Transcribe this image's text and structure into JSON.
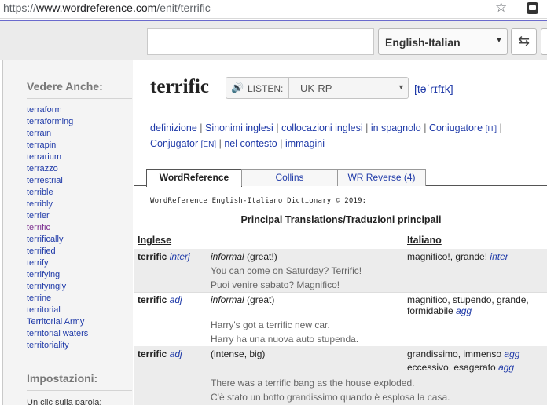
{
  "browser": {
    "url_prefix": "https://",
    "url_host": "www.wordreference.com",
    "url_path": "/enit/terrific",
    "star_glyph": "☆"
  },
  "topbar": {
    "search_value": "",
    "dictionary": "English-Italian",
    "dropdown_caret": "▼",
    "swap_glyph": "⇆"
  },
  "sidebar": {
    "see_also_title": "Vedere Anche:",
    "items": [
      {
        "label": "terraform",
        "visited": false
      },
      {
        "label": "terraforming",
        "visited": false
      },
      {
        "label": "terrain",
        "visited": false
      },
      {
        "label": "terrapin",
        "visited": false
      },
      {
        "label": "terrarium",
        "visited": false
      },
      {
        "label": "terrazzo",
        "visited": false
      },
      {
        "label": "terrestrial",
        "visited": false
      },
      {
        "label": "terrible",
        "visited": false
      },
      {
        "label": "terribly",
        "visited": false
      },
      {
        "label": "terrier",
        "visited": false
      },
      {
        "label": "terrific",
        "visited": true
      },
      {
        "label": "terrifically",
        "visited": false
      },
      {
        "label": "terrified",
        "visited": false
      },
      {
        "label": "terrify",
        "visited": false
      },
      {
        "label": "terrifying",
        "visited": false
      },
      {
        "label": "terrifyingly",
        "visited": false
      },
      {
        "label": "terrine",
        "visited": false
      },
      {
        "label": "territorial",
        "visited": false
      },
      {
        "label": "Territorial Army",
        "visited": false
      },
      {
        "label": "territorial waters",
        "visited": false
      },
      {
        "label": "territoriality",
        "visited": false
      }
    ],
    "settings_title": "Impostazioni:",
    "settings_first": "Un clic sulla parola:"
  },
  "entry": {
    "headword": "terrific",
    "listen_icon": "🔊",
    "listen_label": "LISTEN:",
    "accent": "UK-RP",
    "accent_caret": "▼",
    "ipa": "[təˈrɪfɪk]"
  },
  "links": {
    "definizione": "definizione",
    "sinonimi": "Sinonimi inglesi",
    "collocazioni": "collocazioni inglesi",
    "spagnolo": "in spagnolo",
    "coniugatore_it": "Coniugatore",
    "coniugatore_it_tag": "[IT]",
    "conjugator_en": "Conjugator",
    "conjugator_en_tag": "[EN]",
    "contesto": "nel contesto",
    "immagini": "immagini",
    "sep": "|"
  },
  "tabs": [
    {
      "label": "WordReference",
      "active": true
    },
    {
      "label": "Collins",
      "active": false
    },
    {
      "label": "WR Reverse (4)",
      "active": false
    }
  ],
  "copyright": "WordReference English-Italiano Dictionary © 2019:",
  "section_title": "Principal Translations/Traduzioni principali",
  "columns": {
    "english": "Inglese",
    "italian": "Italiano"
  },
  "rows": [
    {
      "term": "terrific",
      "pos": "interj",
      "context_register": "informal",
      "context_rest": " (great!)",
      "translation": "magnifico!, grande!",
      "translation_pos": "inter",
      "ex_en": "You can come on Saturday? Terrific!",
      "ex_it": "Puoi venire sabato? Magnifico!"
    },
    {
      "term": "terrific",
      "pos": "adj",
      "context_register": "informal",
      "context_rest": " (great)",
      "translation_1": "magnifico, stupendo, grande,",
      "translation_2": "formidabile",
      "translation_pos": "agg",
      "ex_en": "Harry's got a terrific new car.",
      "ex_it": "Harry ha una nuova auto stupenda."
    },
    {
      "term": "terrific",
      "pos": "adj",
      "context": "(intense, big)",
      "translation_1": "grandissimo, immenso",
      "translation_1_pos": "agg",
      "translation_2": "eccessivo, esagerato",
      "translation_2_pos": "agg",
      "ex_en": "There was a terrific bang as the house exploded.",
      "ex_it": "C'è stato un botto grandissimo quando è esplosa la casa."
    }
  ]
}
